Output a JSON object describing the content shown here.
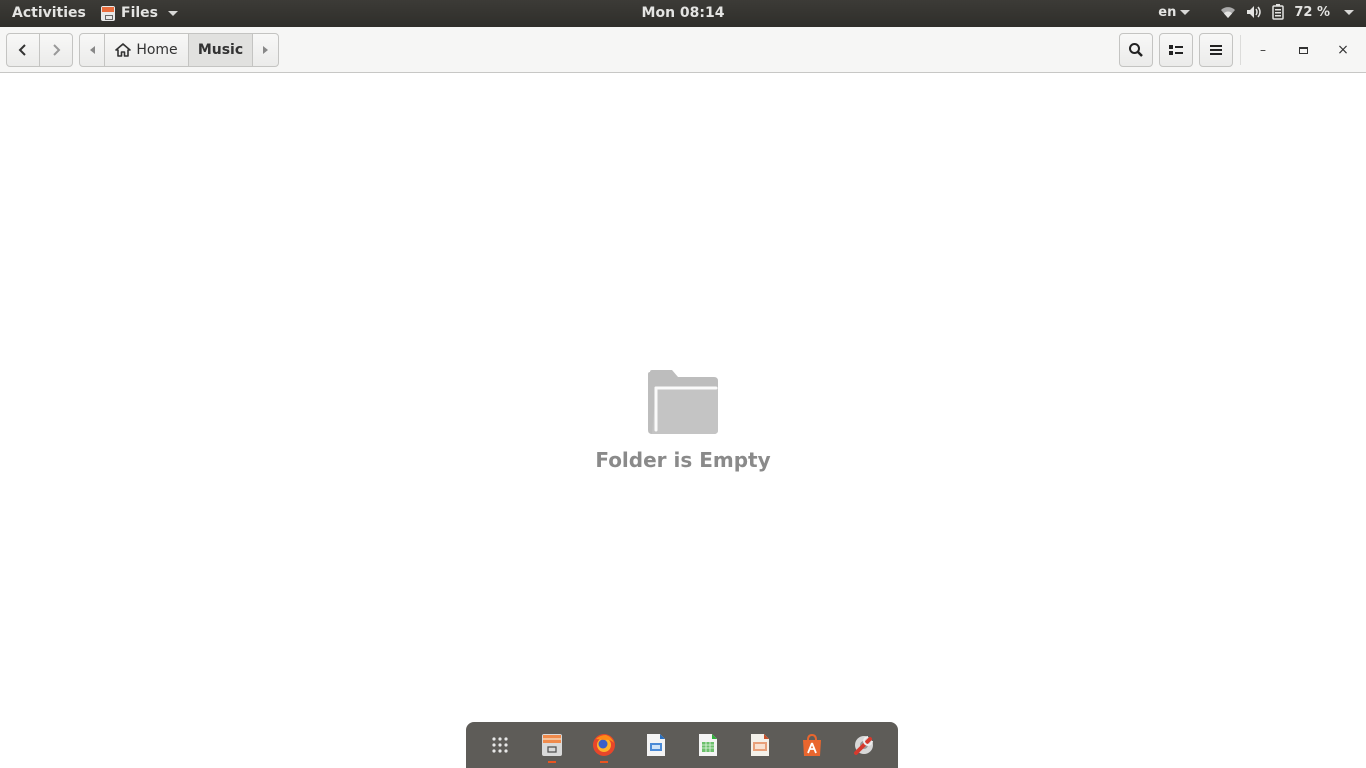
{
  "topbar": {
    "activities": "Activities",
    "app_name": "Files",
    "clock": "Mon 08:14",
    "language": "en",
    "battery": "72 %",
    "icons": [
      "wifi-icon",
      "volume-icon",
      "battery-icon"
    ]
  },
  "headerbar": {
    "back_icon": "chevron-left-icon",
    "forward_icon": "chevron-right-icon",
    "path": [
      {
        "label": "Home",
        "icon": "home-icon"
      },
      {
        "label": "Music",
        "active": true
      }
    ],
    "tools": [
      "search-icon",
      "view-list-icon",
      "menu-icon"
    ],
    "window_controls": {
      "minimize": "–",
      "maximize": "□",
      "close": "×"
    }
  },
  "main": {
    "empty_message": "Folder is Empty",
    "empty_icon": "folder-icon"
  },
  "dock": {
    "items": [
      {
        "name": "show-applications",
        "running": false
      },
      {
        "name": "files",
        "running": true
      },
      {
        "name": "firefox",
        "running": true
      },
      {
        "name": "libreoffice-writer",
        "running": false
      },
      {
        "name": "libreoffice-calc",
        "running": false
      },
      {
        "name": "libreoffice-impress",
        "running": false
      },
      {
        "name": "ubuntu-software",
        "running": false
      },
      {
        "name": "system-settings",
        "running": false
      }
    ],
    "accent": "#e95420"
  }
}
